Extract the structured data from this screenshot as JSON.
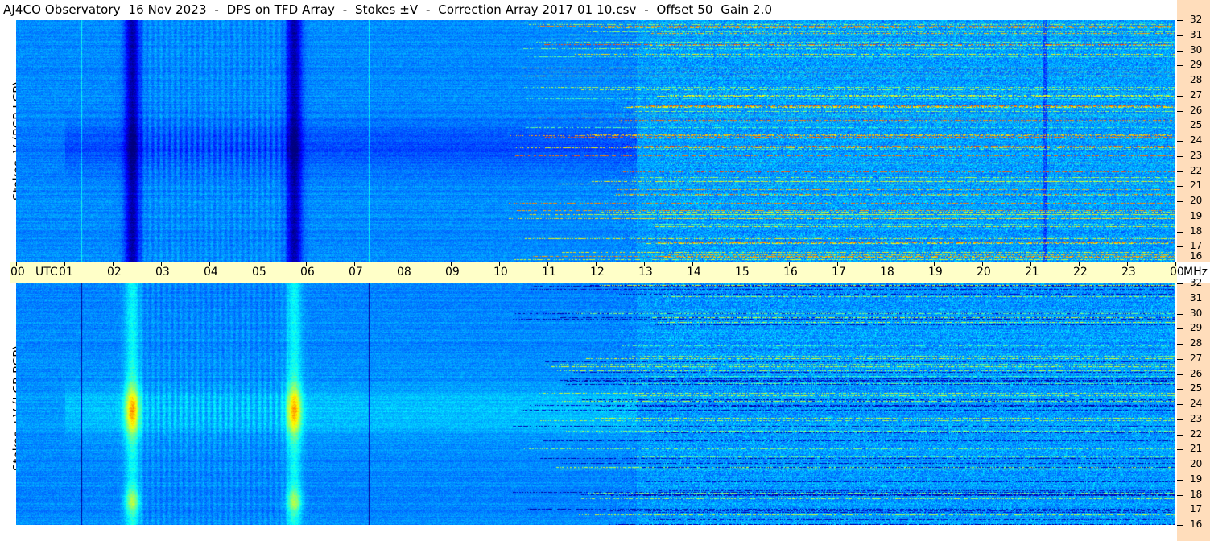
{
  "title": "AJ4CO Observatory  16 Nov 2023  -  DPS on TFD Array  -  Stokes ±V  -  Correction Array 2017 01 10.csv  -  Offset 50  Gain 2.0",
  "chart_data": [
    {
      "type": "heatmap",
      "ylabel": "Stokes -V (RCP-LCP)",
      "x_hours_utc": [
        0,
        24
      ],
      "ylim_mhz": [
        16,
        32
      ],
      "y_ticks": [
        "32",
        "31",
        "30",
        "29",
        "28",
        "27",
        "26",
        "25",
        "24",
        "23",
        "22",
        "21",
        "20",
        "19",
        "18",
        "17",
        "16"
      ],
      "features": {
        "dark_bursts_utc": [
          2.4,
          5.75
        ],
        "thin_vertical_lines_utc": [
          1.35,
          7.3
        ],
        "interference_onset_utc": 11.5,
        "correction_change_utc": 12.85,
        "dark_column_utc": 21.3
      }
    },
    {
      "type": "heatmap",
      "ylabel": "Stokes +V (LCP-RCP)",
      "x_hours_utc": [
        0,
        24
      ],
      "ylim_mhz": [
        16,
        32
      ],
      "y_ticks": [
        "32",
        "31",
        "30",
        "29",
        "28",
        "27",
        "26",
        "25",
        "24",
        "23",
        "22",
        "21",
        "20",
        "19",
        "18",
        "17",
        "16"
      ],
      "features": {
        "bright_bursts_utc": [
          2.4,
          5.75
        ],
        "thin_vertical_lines_utc": [
          1.35,
          7.3
        ],
        "interference_onset_utc": 11.5,
        "correction_change_utc": 12.85
      }
    }
  ],
  "time_axis": {
    "labels": [
      "00",
      "UTC",
      "01",
      "02",
      "03",
      "04",
      "05",
      "06",
      "07",
      "08",
      "09",
      "10",
      "11",
      "12",
      "13",
      "14",
      "15",
      "16",
      "17",
      "18",
      "19",
      "20",
      "21",
      "22",
      "23",
      "00"
    ],
    "unit": "MHz"
  },
  "colors": {
    "axis_bg": "#ffffc8",
    "freq_bg": "#ffddbb"
  }
}
